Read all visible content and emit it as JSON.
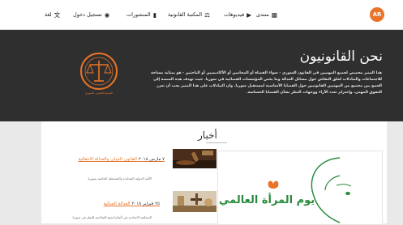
{
  "nav": {
    "brand": "AR",
    "items": [
      {
        "label": "منتدى",
        "icon": "chat-icon"
      },
      {
        "label": "فيديوهات",
        "icon": "video-icon"
      },
      {
        "label": "المكتبة القانونية",
        "icon": "gavel-icon"
      },
      {
        "label": "المنشورات",
        "icon": "book-icon"
      },
      {
        "label": "تسجيل دخول",
        "icon": "user-icon"
      },
      {
        "label": "لغة",
        "icon": "translate-icon"
      }
    ]
  },
  "hero": {
    "title": "نحن القانونيون",
    "text": "هذا المنبر مخصص لجميع المهنيين في القانون السوري - سواء القضاة أو المحامين أو الأكاديميين أو الباحثين - هو بمثابة مساحة للاجتماعات والتبادلات لخلق النقاش حول مسائل العدالة وما يخص المؤسسات القضائية في سوريا. حيث تهدف هذه المنصة إلى الجمع بين مجتمع من المهنيين القانونيين حول القضايا الأساسية لمستقبل سوريا. وان التبادلات على هذا المنبر يجب أن تعزز التفوق المهني، وإحترام تعدد الآراء ووجهات النظر بشأن القضايا الحساسة.",
    "logo_caption": "التجمع القانوني السوري"
  },
  "news": {
    "heading": "أخبار",
    "items": [
      {
        "date": "٧ مارس ٢٠١٨",
        "title": "القانون الدولي والعدالة الانتقالية",
        "desc": "الآلية الدولية المحايدة والمستقلة الخاصة بسوريا"
      },
      {
        "date": "٢٥ فبراير ٢٠١٨",
        "title": "العدالة الجنائية",
        "desc": "المحكمة الاتحادية في ألمانيا تمنح الصلاحية للنظر في سوريا"
      }
    ],
    "banner_text": "يوم المرأة العالمي"
  }
}
